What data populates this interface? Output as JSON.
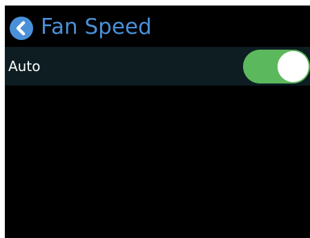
{
  "header": {
    "back_icon": "chevron-left-icon",
    "title": "Fan Speed"
  },
  "settings": {
    "auto": {
      "label": "Auto",
      "enabled": true
    }
  },
  "colors": {
    "accent": "#4a90d9",
    "toggle_on": "#5cb85c",
    "row_background": "#0d1d22",
    "screen_background": "#000000"
  }
}
